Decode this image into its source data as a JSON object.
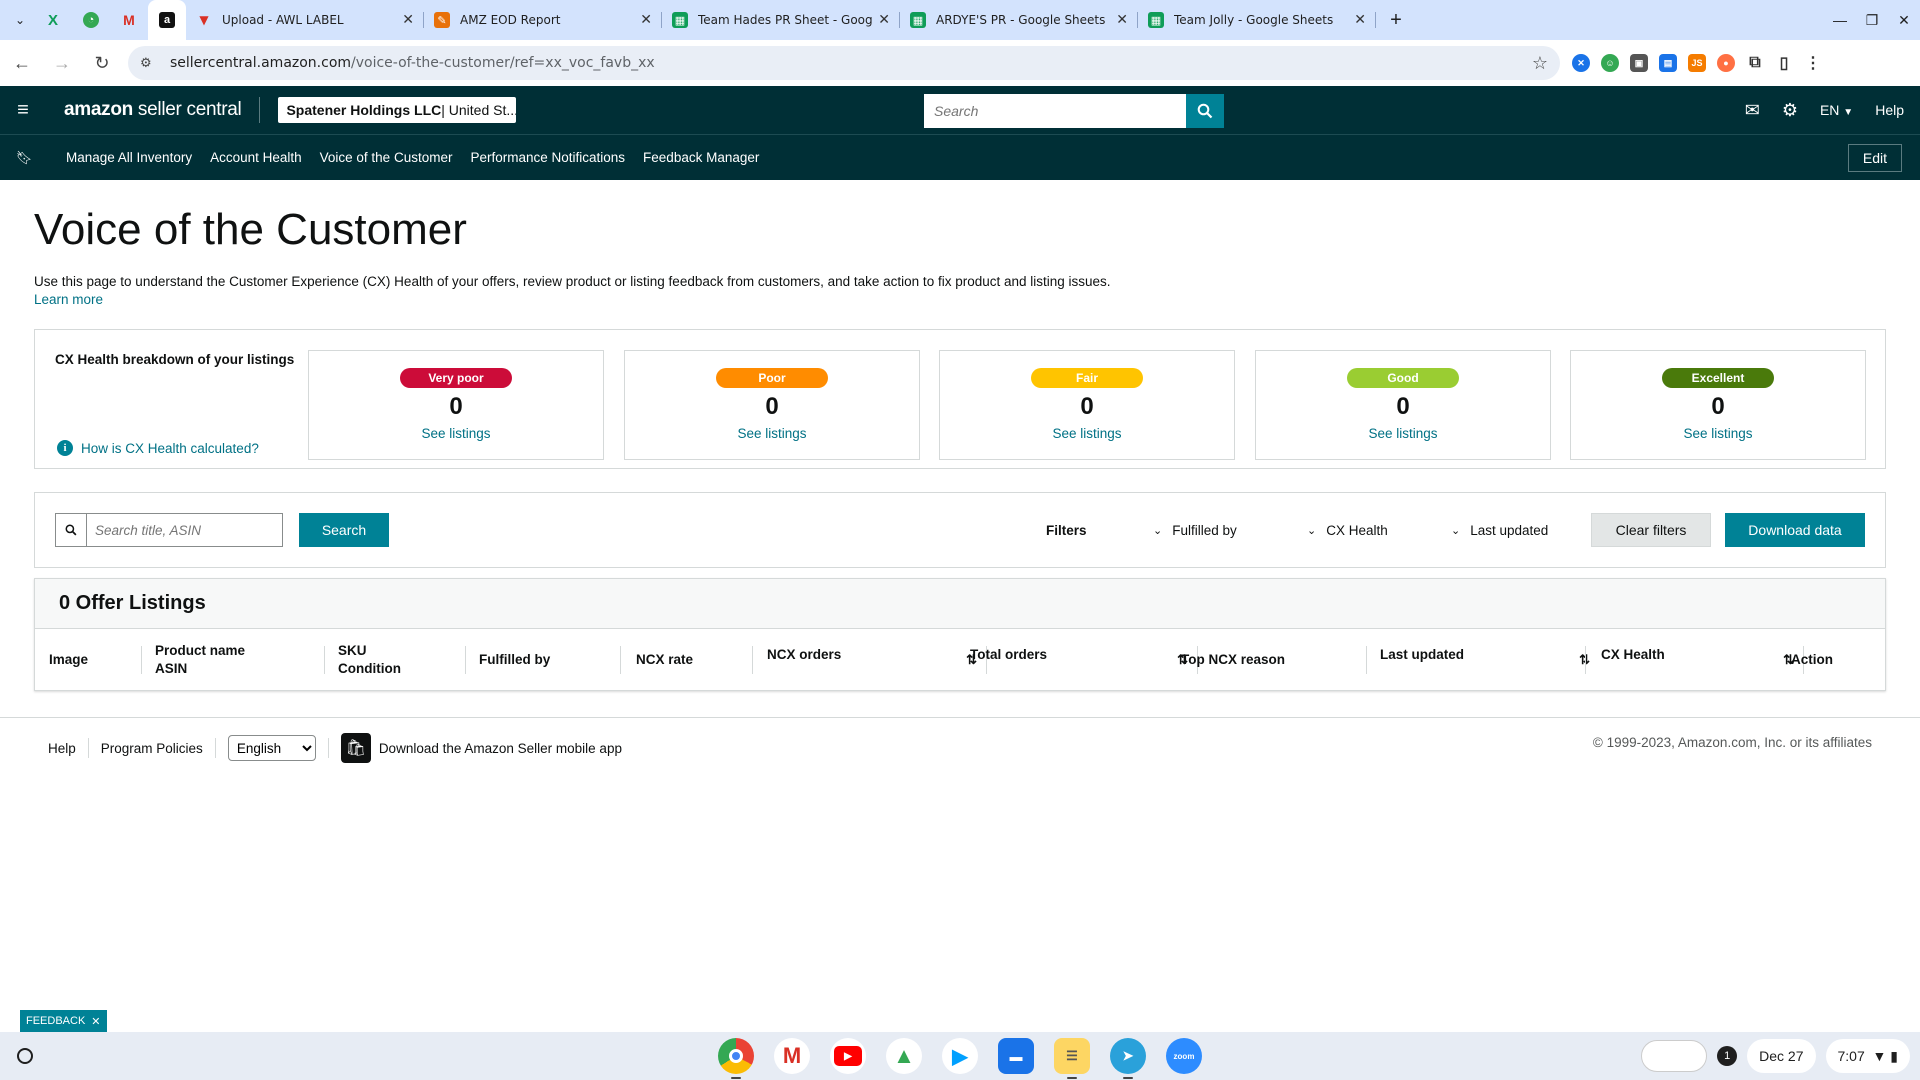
{
  "browser": {
    "tabs": [
      {
        "title": "Upload - AWL LABEL",
        "fav_color": "#d93025",
        "fav_glyph": "▼"
      },
      {
        "title": "AMZ EOD Report",
        "fav_color": "#e8710a",
        "fav_glyph": "✎"
      },
      {
        "title": "Team Hades PR Sheet - Google Sheets",
        "fav_color": "#0f9d58",
        "fav_glyph": "▦"
      },
      {
        "title": "ARDYE'S PR - Google Sheets",
        "fav_color": "#0f9d58",
        "fav_glyph": "▦"
      },
      {
        "title": "Team Jolly - Google Sheets",
        "fav_color": "#0f9d58",
        "fav_glyph": "▦"
      }
    ],
    "url_host": "sellercentral.amazon.com",
    "url_path": "/voice-of-the-customer/ref=xx_voc_favb_xx"
  },
  "header": {
    "logo_bold": "amazon",
    "logo_rest": " seller central",
    "account_name": "Spatener Holdings LLC",
    "account_region": " | United St...",
    "search_placeholder": "Search",
    "language": "EN",
    "help": "Help"
  },
  "nav": {
    "items": [
      "Manage All Inventory",
      "Account Health",
      "Voice of the Customer",
      "Performance Notifications",
      "Feedback Manager"
    ],
    "edit_label": "Edit"
  },
  "page": {
    "title": "Voice of the Customer",
    "description": "Use this page to understand the Customer Experience (CX) Health of your offers, review product or listing feedback from customers, and take action to fix product and listing issues.",
    "learn_more": "Learn more"
  },
  "cx_health": {
    "label": "CX Health breakdown of your listings",
    "how_link": "How is CX Health calculated?",
    "cards": [
      {
        "badge": "Very poor",
        "count": "0",
        "link": "See listings",
        "color": "#cc0c39"
      },
      {
        "badge": "Poor",
        "count": "0",
        "link": "See listings",
        "color": "#ff8c00"
      },
      {
        "badge": "Fair",
        "count": "0",
        "link": "See listings",
        "color": "#ffc400"
      },
      {
        "badge": "Good",
        "count": "0",
        "link": "See listings",
        "color": "#9acd32"
      },
      {
        "badge": "Excellent",
        "count": "0",
        "link": "See listings",
        "color": "#4a7a0b"
      }
    ]
  },
  "filters": {
    "search_placeholder": "Search title, ASIN",
    "search_button": "Search",
    "filters_label": "Filters",
    "fulfilled_by": "Fulfilled by",
    "cx_health": "CX Health",
    "last_updated": "Last updated",
    "clear_button": "Clear filters",
    "download_button": "Download data"
  },
  "listings": {
    "heading": "0 Offer Listings",
    "columns": {
      "image": "Image",
      "product_name": "Product name",
      "asin": "ASIN",
      "sku": "SKU",
      "condition": "Condition",
      "fulfilled_by": "Fulfilled by",
      "ncx_rate": "NCX rate",
      "ncx_orders": "NCX orders",
      "total_orders": "Total orders",
      "top_ncx_reason": "Top NCX reason",
      "last_updated": "Last updated",
      "cx_health": "CX Health",
      "action": "Action"
    }
  },
  "footer": {
    "help": "Help",
    "program_policies": "Program Policies",
    "language_selected": "English",
    "mobile_app": "Download the Amazon Seller mobile app",
    "copyright": "© 1999-2023, Amazon.com, Inc. or its affiliates"
  },
  "feedback_tab": "FEEDBACK",
  "shelf": {
    "notification_count": "1",
    "date": "Dec 27",
    "time": "7:07"
  },
  "colors": {
    "header_bg": "#002f36",
    "accent": "#008296",
    "link": "#007185"
  }
}
